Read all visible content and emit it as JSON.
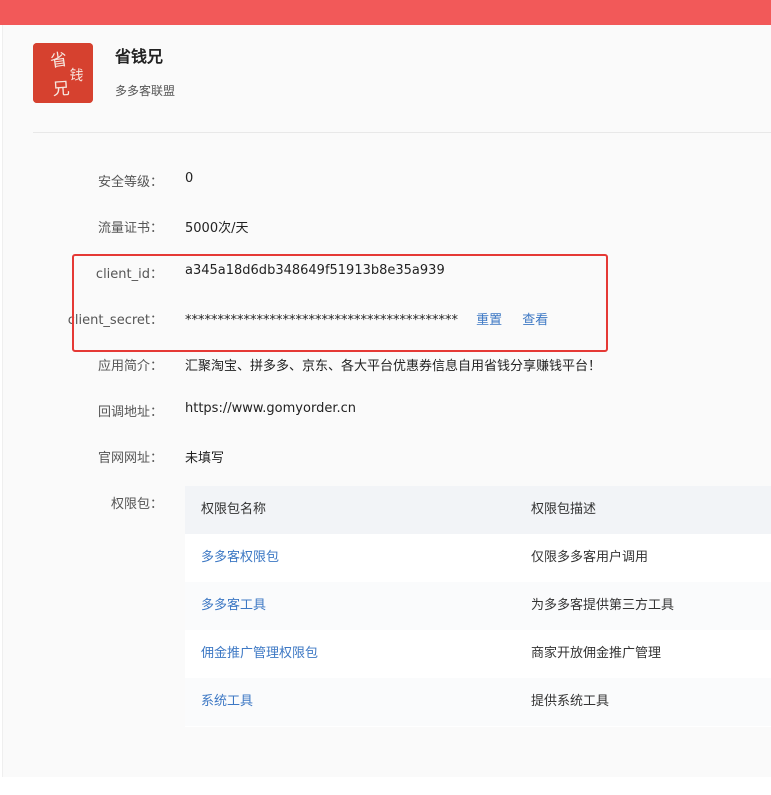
{
  "app": {
    "name": "省钱兄",
    "subtitle": "多多客联盟",
    "logo_text": "省钱兄"
  },
  "fields": {
    "security_level": {
      "label": "安全等级：",
      "value": "0"
    },
    "traffic_cert": {
      "label": "流量证书：",
      "value": "5000次/天"
    },
    "client_id": {
      "label": "client_id：",
      "value": "a345a18d6db348649f51913b8e35a939"
    },
    "client_secret": {
      "label": "client_secret：",
      "value": "******************************************",
      "reset_label": "重置",
      "view_label": "查看"
    },
    "intro": {
      "label": "应用简介：",
      "value": "汇聚淘宝、拼多多、京东、各大平台优惠券信息自用省钱分享赚钱平台！"
    },
    "callback": {
      "label": "回调地址：",
      "value": "https://www.gomyorder.cn"
    },
    "website": {
      "label": "官网网址：",
      "value": "未填写"
    },
    "permissions": {
      "label": "权限包："
    }
  },
  "perm_table": {
    "headers": [
      "权限包名称",
      "权限包描述"
    ],
    "rows": [
      {
        "name": "多多客权限包",
        "desc": "仅限多多客用户调用"
      },
      {
        "name": "多多客工具",
        "desc": "为多多客提供第三方工具"
      },
      {
        "name": "佣金推广管理权限包",
        "desc": "商家开放佣金推广管理"
      },
      {
        "name": "系统工具",
        "desc": "提供系统工具"
      }
    ]
  },
  "colors": {
    "top_bar": "#f25959",
    "logo_bg": "#d6412f",
    "link": "#3d78c4",
    "highlight_border": "#e53935"
  }
}
